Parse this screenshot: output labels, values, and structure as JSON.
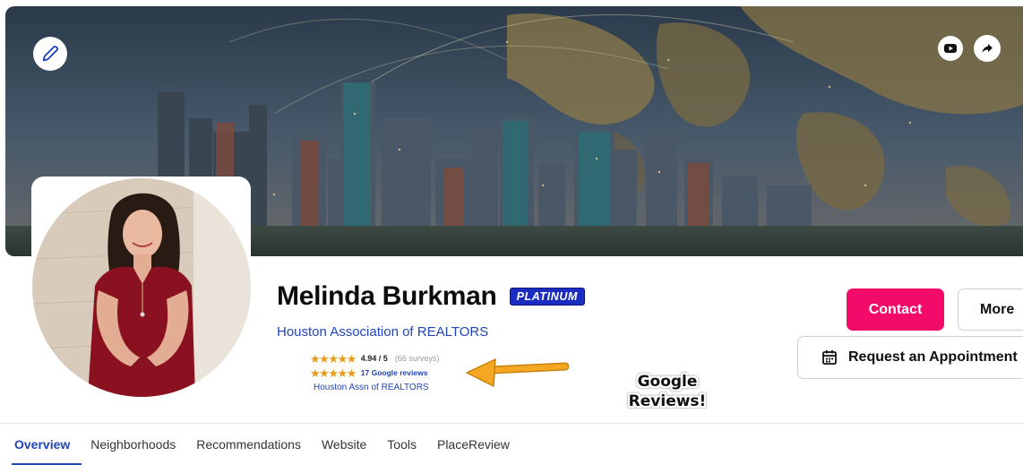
{
  "banner": {
    "edit_icon": "pencil-icon",
    "youtube_icon": "youtube-icon",
    "share_icon": "share-arrow-icon"
  },
  "agent": {
    "name": "Melinda Burkman",
    "badge": "PLATINUM",
    "association": "Houston Association of REALTORS"
  },
  "ratings": {
    "score": "4.94 / 5",
    "surveys": "(66 surveys)",
    "google_reviews": "17 Google reviews",
    "association_short": "Houston Assn of REALTORS",
    "star_rating": 4.94,
    "star_max": 5
  },
  "callout": {
    "line1": "Google",
    "line2": "Reviews!"
  },
  "actions": {
    "contact": "Contact",
    "more": "More",
    "appointment": "Request an Appointment"
  },
  "tabs": [
    {
      "label": "Overview",
      "active": true
    },
    {
      "label": "Neighborhoods",
      "active": false
    },
    {
      "label": "Recommendations",
      "active": false
    },
    {
      "label": "Website",
      "active": false
    },
    {
      "label": "Tools",
      "active": false
    },
    {
      "label": "PlaceReview",
      "active": false
    }
  ],
  "colors": {
    "brand_pink": "#f30b6a",
    "link_blue": "#2146b8",
    "badge_blue": "#1b2cc1",
    "star_orange": "#e79a1c",
    "arrow_orange": "#f5a623"
  }
}
